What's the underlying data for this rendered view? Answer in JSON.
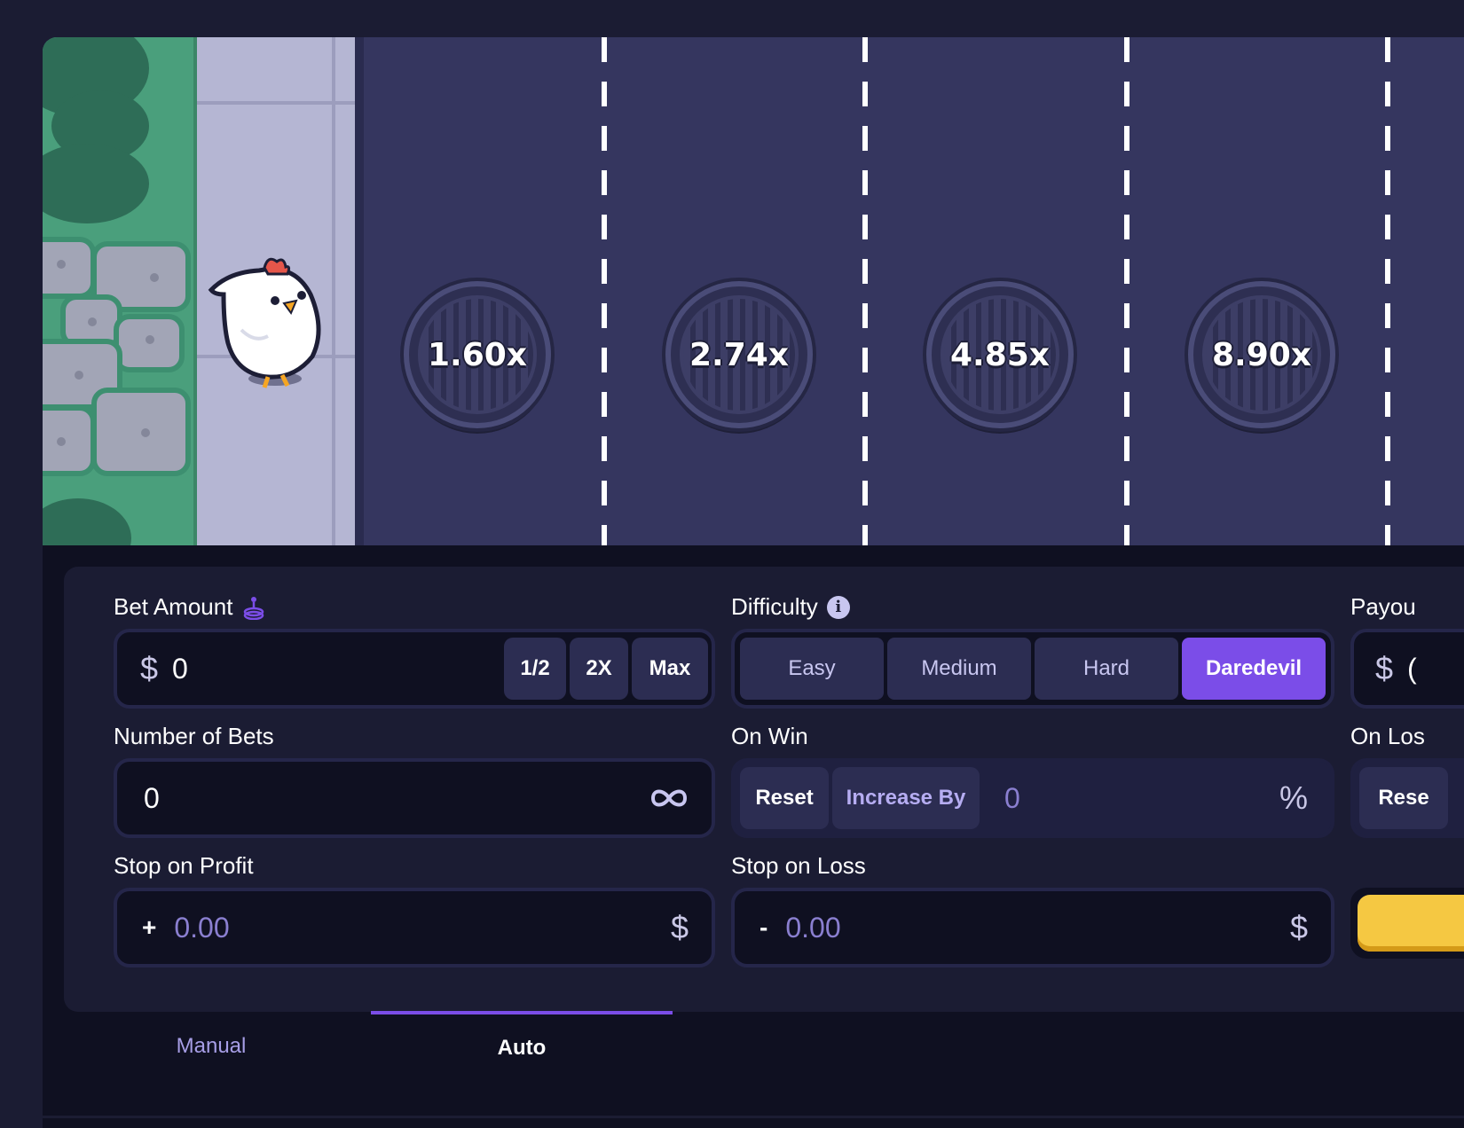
{
  "game": {
    "multipliers": [
      "1.60x",
      "2.74x",
      "4.85x",
      "8.90x"
    ]
  },
  "bet": {
    "label": "Bet Amount",
    "currency": "$",
    "value": "0",
    "half_label": "1/2",
    "double_label": "2X",
    "max_label": "Max"
  },
  "difficulty": {
    "label": "Difficulty",
    "options": [
      "Easy",
      "Medium",
      "Hard",
      "Daredevil"
    ],
    "selected": "Daredevil"
  },
  "payout": {
    "label": "Payou",
    "currency": "$",
    "value": "("
  },
  "number_of_bets": {
    "label": "Number of Bets",
    "value": "0"
  },
  "on_win": {
    "label": "On Win",
    "reset_label": "Reset",
    "increase_label": "Increase By",
    "value": "0",
    "unit": "%"
  },
  "on_loss": {
    "label": "On Los",
    "reset_label": "Rese"
  },
  "stop_on_profit": {
    "label": "Stop on Profit",
    "sign": "+",
    "placeholder": "0.00",
    "currency": "$"
  },
  "stop_on_loss": {
    "label": "Stop on Loss",
    "sign": "-",
    "placeholder": "0.00",
    "currency": "$"
  },
  "tabs": {
    "manual": "Manual",
    "auto": "Auto",
    "active": "Auto"
  },
  "colors": {
    "accent": "#7b4de8",
    "panel": "#1b1c33",
    "input_bg": "#0f1021",
    "road": "#35365f",
    "grass": "#4a9f7c",
    "play_button": "#f5c842"
  }
}
